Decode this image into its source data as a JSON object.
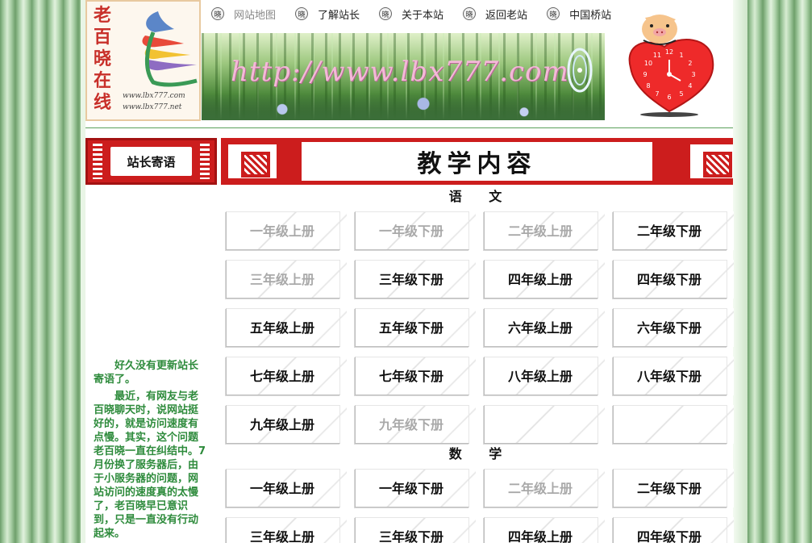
{
  "logo": {
    "chars": [
      "老",
      "百",
      "晓",
      "在",
      "线"
    ],
    "url1": "www.lbx777.com",
    "url2": "www.lbx777.net"
  },
  "nav": {
    "icon_char": "晓",
    "items": [
      "网站地图",
      "了解站长",
      "关于本站",
      "返回老站",
      "中国桥站"
    ]
  },
  "banner": {
    "url": "http://www.lbx777.com"
  },
  "mascot": {
    "clock_digits": [
      "12",
      "1",
      "2",
      "3",
      "4",
      "5",
      "6",
      "7",
      "8",
      "9",
      "10",
      "11"
    ]
  },
  "sidebar": {
    "title": "站长寄语",
    "paragraphs": [
      "好久没有更新站长寄语了。",
      "最近，有网友与老百晓聊天时，说网站挺好的，就是访问速度有点慢。其实，这个问题老百晓一直在纠结中。7月份换了服务器后，由于小服务器的问题，网站访问的速度真的太慢了，老百晓早已意识到，只是一直没有行动起来。"
    ]
  },
  "main": {
    "title": "教学内容",
    "subjects": [
      {
        "name": "语 文",
        "books": [
          {
            "label": "一年级上册",
            "active": false
          },
          {
            "label": "一年级下册",
            "active": false
          },
          {
            "label": "二年级上册",
            "active": false
          },
          {
            "label": "二年级下册",
            "active": true
          },
          {
            "label": "三年级上册",
            "active": false
          },
          {
            "label": "三年级下册",
            "active": true
          },
          {
            "label": "四年级上册",
            "active": true
          },
          {
            "label": "四年级下册",
            "active": true
          },
          {
            "label": "五年级上册",
            "active": true
          },
          {
            "label": "五年级下册",
            "active": true
          },
          {
            "label": "六年级上册",
            "active": true
          },
          {
            "label": "六年级下册",
            "active": true
          },
          {
            "label": "七年级上册",
            "active": true
          },
          {
            "label": "七年级下册",
            "active": true
          },
          {
            "label": "八年级上册",
            "active": true
          },
          {
            "label": "八年级下册",
            "active": true
          },
          {
            "label": "九年级上册",
            "active": true
          },
          {
            "label": "九年级下册",
            "active": false
          },
          {
            "label": "",
            "active": true
          },
          {
            "label": "",
            "active": true
          }
        ]
      },
      {
        "name": "数 学",
        "books": [
          {
            "label": "一年级上册",
            "active": true
          },
          {
            "label": "一年级下册",
            "active": true
          },
          {
            "label": "二年级上册",
            "active": false
          },
          {
            "label": "二年级下册",
            "active": true
          },
          {
            "label": "三年级上册",
            "active": true
          },
          {
            "label": "三年级下册",
            "active": true
          },
          {
            "label": "四年级上册",
            "active": true
          },
          {
            "label": "四年级下册",
            "active": true
          }
        ]
      }
    ]
  },
  "colors": {
    "accent_red": "#cc1d1d",
    "sidebar_text": "#2e8b3c",
    "band_green": "#9fc79c",
    "dim_text": "#a9a9a9"
  }
}
